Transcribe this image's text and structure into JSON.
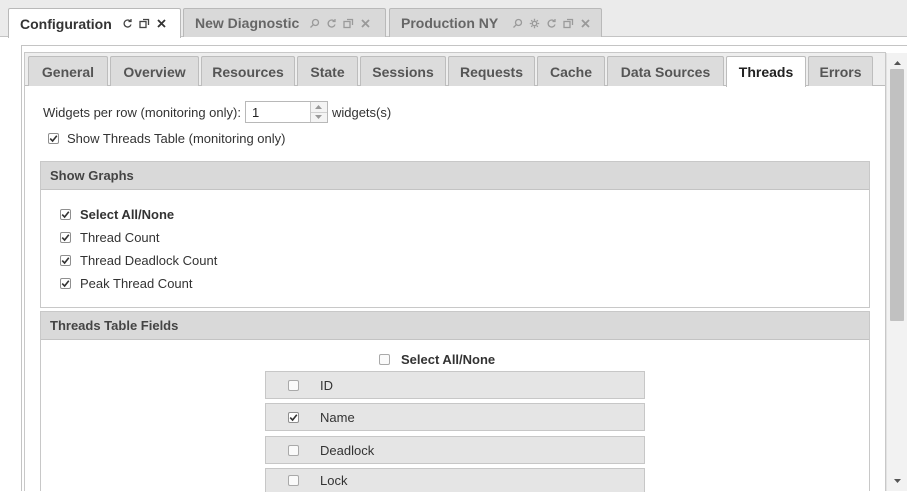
{
  "doc_tabs": [
    {
      "label": "Configuration",
      "active": true
    },
    {
      "label": "New Diagnostic",
      "active": false
    },
    {
      "label": "Production NY",
      "active": false
    }
  ],
  "sub_tabs": [
    "General",
    "Overview",
    "Resources",
    "State",
    "Sessions",
    "Requests",
    "Cache",
    "Data Sources",
    "Threads",
    "Errors"
  ],
  "active_sub_tab": "Threads",
  "widgets": {
    "label": "Widgets per row (monitoring only):",
    "value": "1",
    "suffix": "widgets(s)"
  },
  "show_threads_table": {
    "label": "Show Threads Table (monitoring only)",
    "checked": true
  },
  "show_graphs": {
    "title": "Show Graphs",
    "select_all": {
      "label": "Select All/None",
      "checked": true
    },
    "items": [
      {
        "label": "Thread Count",
        "checked": true
      },
      {
        "label": "Thread Deadlock Count",
        "checked": true
      },
      {
        "label": "Peak Thread Count",
        "checked": true
      }
    ]
  },
  "threads_table_fields": {
    "title": "Threads Table Fields",
    "select_all": {
      "label": "Select All/None",
      "checked": false
    },
    "fields": [
      {
        "label": "ID",
        "checked": false
      },
      {
        "label": "Name",
        "checked": true
      },
      {
        "label": "Deadlock",
        "checked": false
      },
      {
        "label": "Lock",
        "checked": false
      }
    ]
  },
  "colors": {
    "tab_active_bg": "#ffffff",
    "tab_inactive_bg": "#d9d9d9",
    "section_header_bg": "#d9d9d9",
    "field_row_bg": "#e5e5e5"
  }
}
